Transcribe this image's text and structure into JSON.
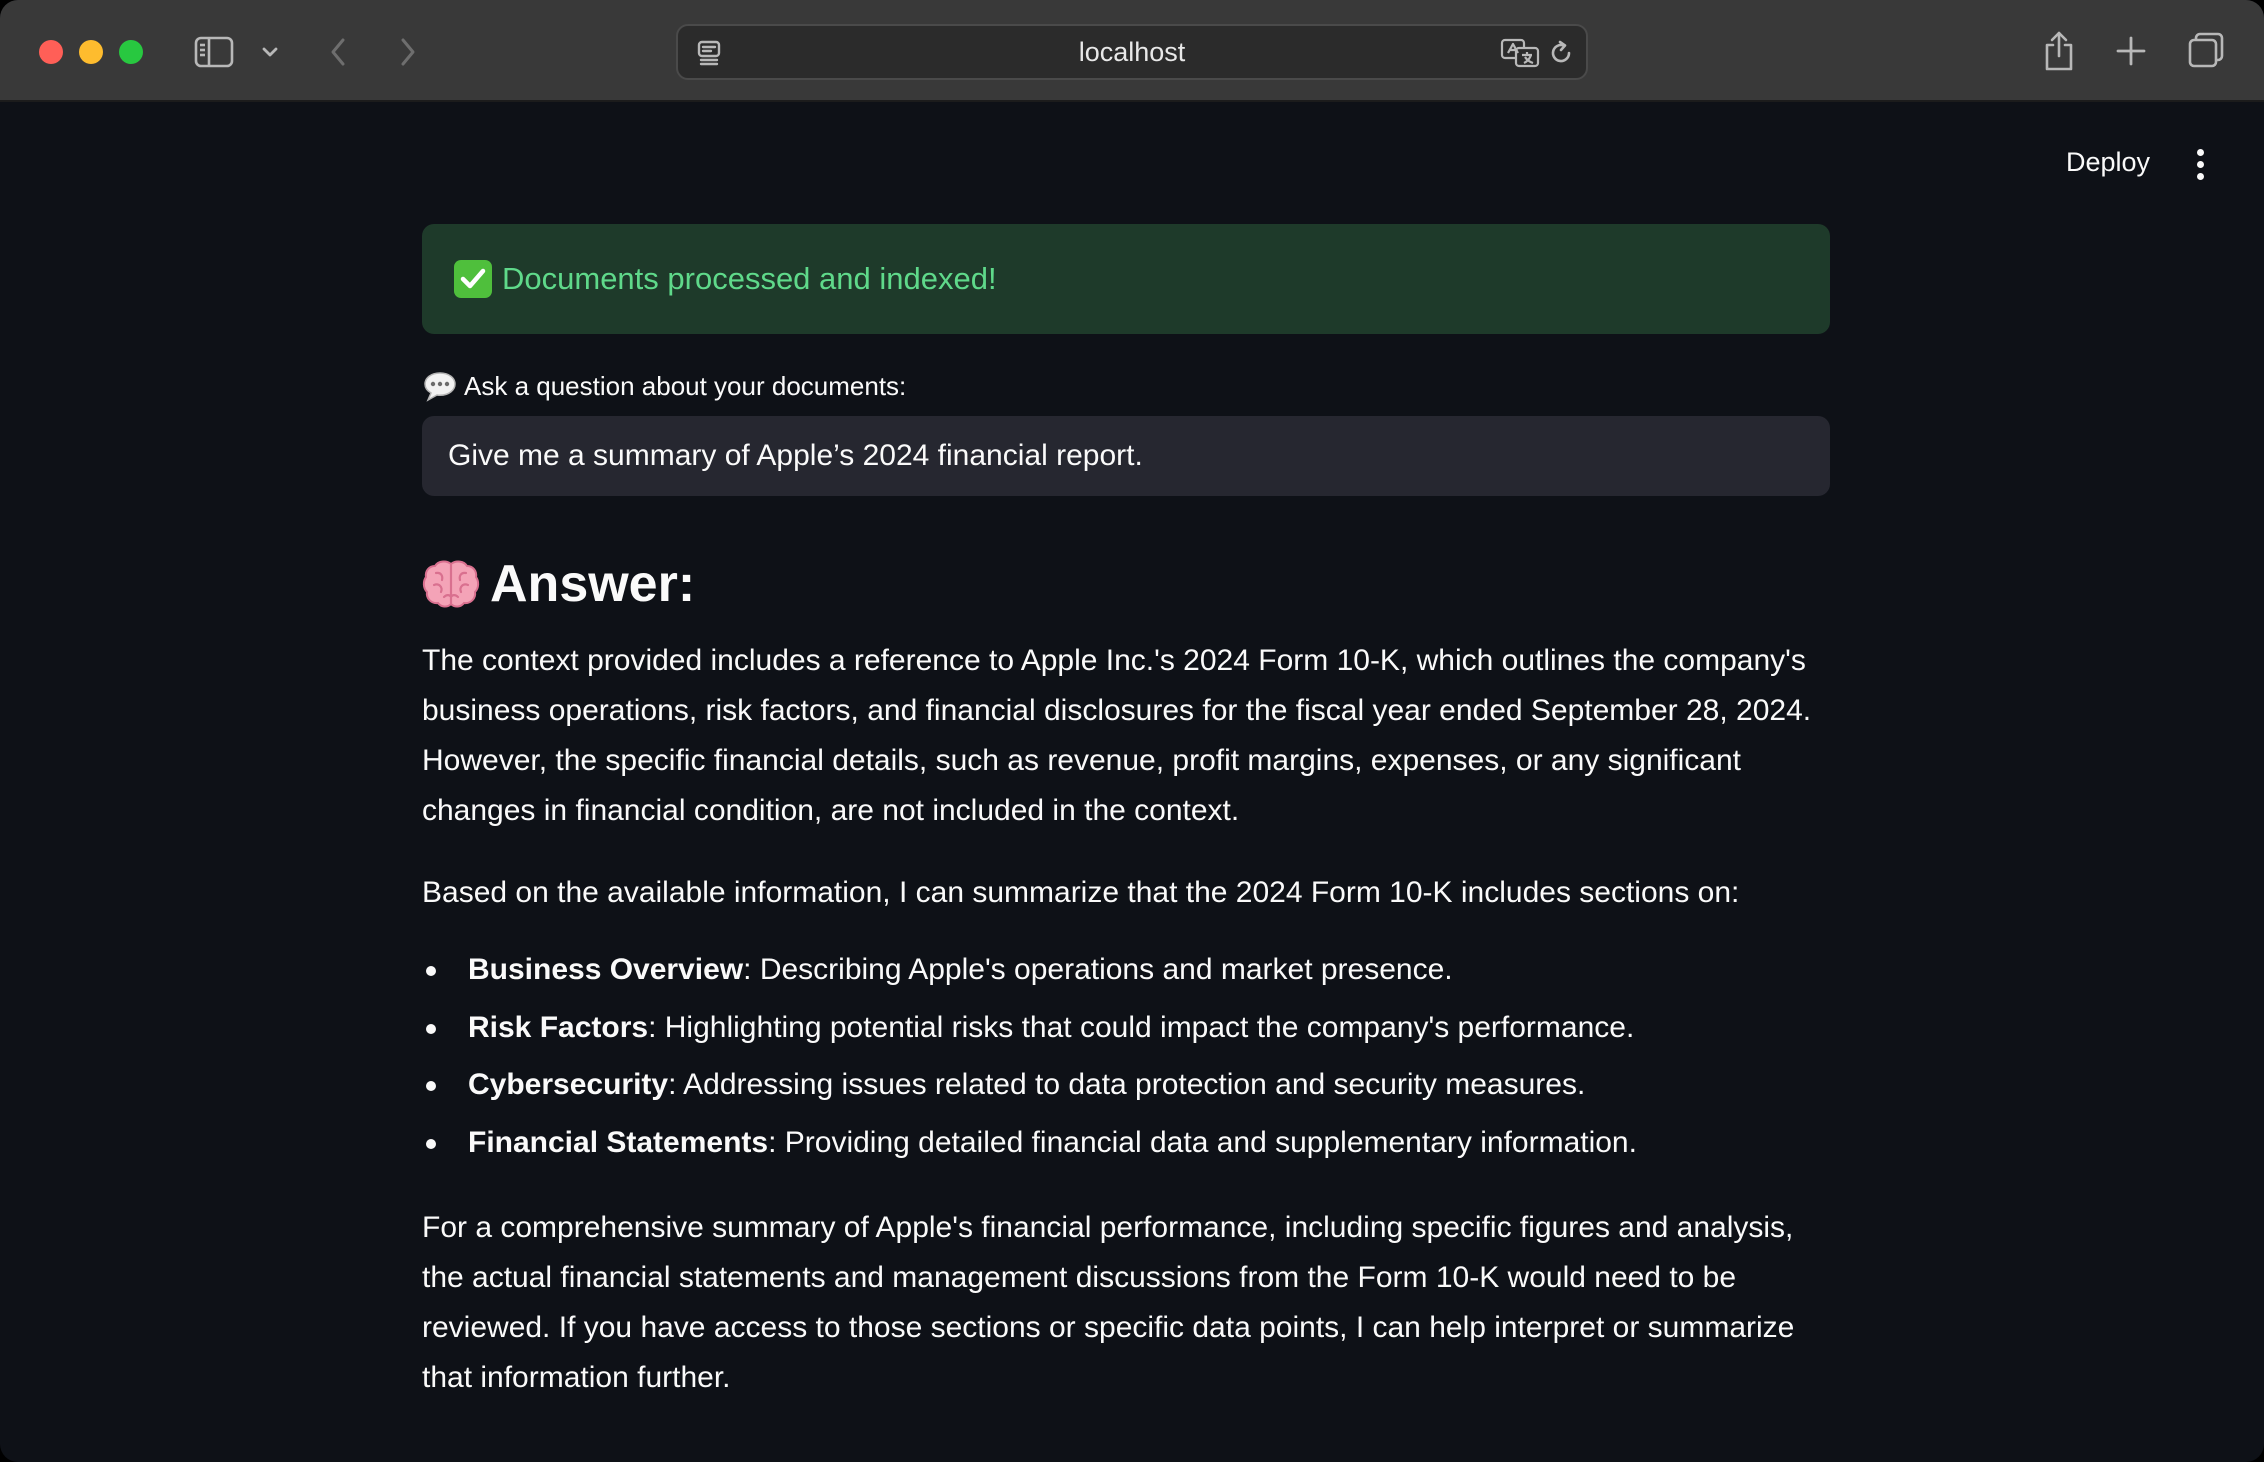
{
  "browser": {
    "url": "localhost"
  },
  "header": {
    "deploy_label": "Deploy"
  },
  "status": {
    "success_message": "Documents processed and indexed!"
  },
  "question": {
    "label": "Ask a question about your documents:",
    "value": "Give me a summary of Apple’s 2024 financial report."
  },
  "answer": {
    "heading": "Answer:",
    "paragraph_1": "The context provided includes a reference to Apple Inc.'s 2024 Form 10-K, which outlines the company's business operations, risk factors, and financial disclosures for the fiscal year ended September 28, 2024. However, the specific financial details, such as revenue, profit margins, expenses, or any significant changes in financial condition, are not included in the context.",
    "paragraph_2": "Based on the available information, I can summarize that the 2024 Form 10-K includes sections on:",
    "bullets": [
      {
        "term": "Business Overview",
        "text": ": Describing Apple's operations and market presence."
      },
      {
        "term": "Risk Factors",
        "text": ": Highlighting potential risks that could impact the company's performance."
      },
      {
        "term": "Cybersecurity",
        "text": ": Addressing issues related to data protection and security measures."
      },
      {
        "term": "Financial Statements",
        "text": ": Providing detailed financial data and supplementary information."
      }
    ],
    "paragraph_3": "For a comprehensive summary of Apple's financial performance, including specific figures and analysis, the actual financial statements and management discussions from the Form 10-K would need to be reviewed. If you have access to those sections or specific data points, I can help interpret or summarize that information further."
  },
  "colors": {
    "app_background": "#0e1117",
    "success_background": "#1e3a2a",
    "success_text": "#5fd98a",
    "input_background": "#262730",
    "text": "#fafafa"
  },
  "icons": {
    "success": "check-mark-button-icon",
    "question": "speech-bubble-icon",
    "answer": "brain-icon"
  }
}
